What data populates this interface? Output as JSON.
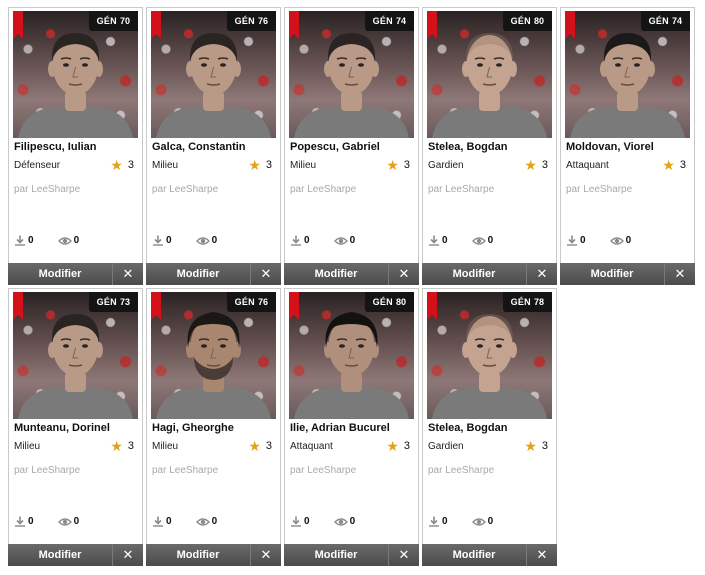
{
  "colors": {
    "ribbon": "#d4101a",
    "badge_bg": "#141414",
    "star": "#e3a21a",
    "action_bar": "#555555",
    "author_text": "#a8a8a8"
  },
  "labels": {
    "gen_prefix": "GÉN",
    "modify": "Modifier",
    "close": "✕"
  },
  "cards": [
    {
      "name": "Filipescu, Iulian",
      "gen": "70",
      "position": "Défenseur",
      "rating": "3",
      "author": "par LeeSharpe",
      "downloads": "0",
      "views": "0",
      "face": {
        "skin": "#b89a86",
        "hair": "#2a2522",
        "hair_style": "short",
        "beard": false
      }
    },
    {
      "name": "Galca, Constantin",
      "gen": "76",
      "position": "Milieu",
      "rating": "3",
      "author": "par LeeSharpe",
      "downloads": "0",
      "views": "0",
      "face": {
        "skin": "#b89a86",
        "hair": "#2a2522",
        "hair_style": "short",
        "beard": false
      }
    },
    {
      "name": "Popescu, Gabriel",
      "gen": "74",
      "position": "Milieu",
      "rating": "3",
      "author": "par LeeSharpe",
      "downloads": "0",
      "views": "0",
      "face": {
        "skin": "#b89a86",
        "hair": "#2a2522",
        "hair_style": "short",
        "beard": false
      }
    },
    {
      "name": "Stelea, Bogdan",
      "gen": "80",
      "position": "Gardien",
      "rating": "3",
      "author": "par LeeSharpe",
      "downloads": "0",
      "views": "0",
      "face": {
        "skin": "#c4a490",
        "hair": "#8f7665",
        "hair_style": "bald",
        "beard": false
      }
    },
    {
      "name": "Moldovan, Viorel",
      "gen": "74",
      "position": "Attaquant",
      "rating": "3",
      "author": "par LeeSharpe",
      "downloads": "0",
      "views": "0",
      "face": {
        "skin": "#b89a86",
        "hair": "#1c1a19",
        "hair_style": "short",
        "beard": false
      }
    },
    {
      "name": "Munteanu, Dorinel",
      "gen": "73",
      "position": "Milieu",
      "rating": "3",
      "author": "par LeeSharpe",
      "downloads": "0",
      "views": "0",
      "face": {
        "skin": "#b89a86",
        "hair": "#2a2522",
        "hair_style": "short",
        "beard": false
      }
    },
    {
      "name": "Hagi, Gheorghe",
      "gen": "76",
      "position": "Milieu",
      "rating": "3",
      "author": "par LeeSharpe",
      "downloads": "0",
      "views": "0",
      "face": {
        "skin": "#a98670",
        "hair": "#1b1816",
        "hair_style": "curly",
        "beard": true
      }
    },
    {
      "name": "Ilie, Adrian Bucurel",
      "gen": "80",
      "position": "Attaquant",
      "rating": "3",
      "author": "par LeeSharpe",
      "downloads": "0",
      "views": "0",
      "face": {
        "skin": "#b0907c",
        "hair": "#141211",
        "hair_style": "curly",
        "beard": false
      }
    },
    {
      "name": "Stelea, Bogdan",
      "gen": "78",
      "position": "Gardien",
      "rating": "3",
      "author": "par LeeSharpe",
      "downloads": "0",
      "views": "0",
      "face": {
        "skin": "#c4a490",
        "hair": "#8f7665",
        "hair_style": "bald",
        "beard": false
      }
    }
  ]
}
